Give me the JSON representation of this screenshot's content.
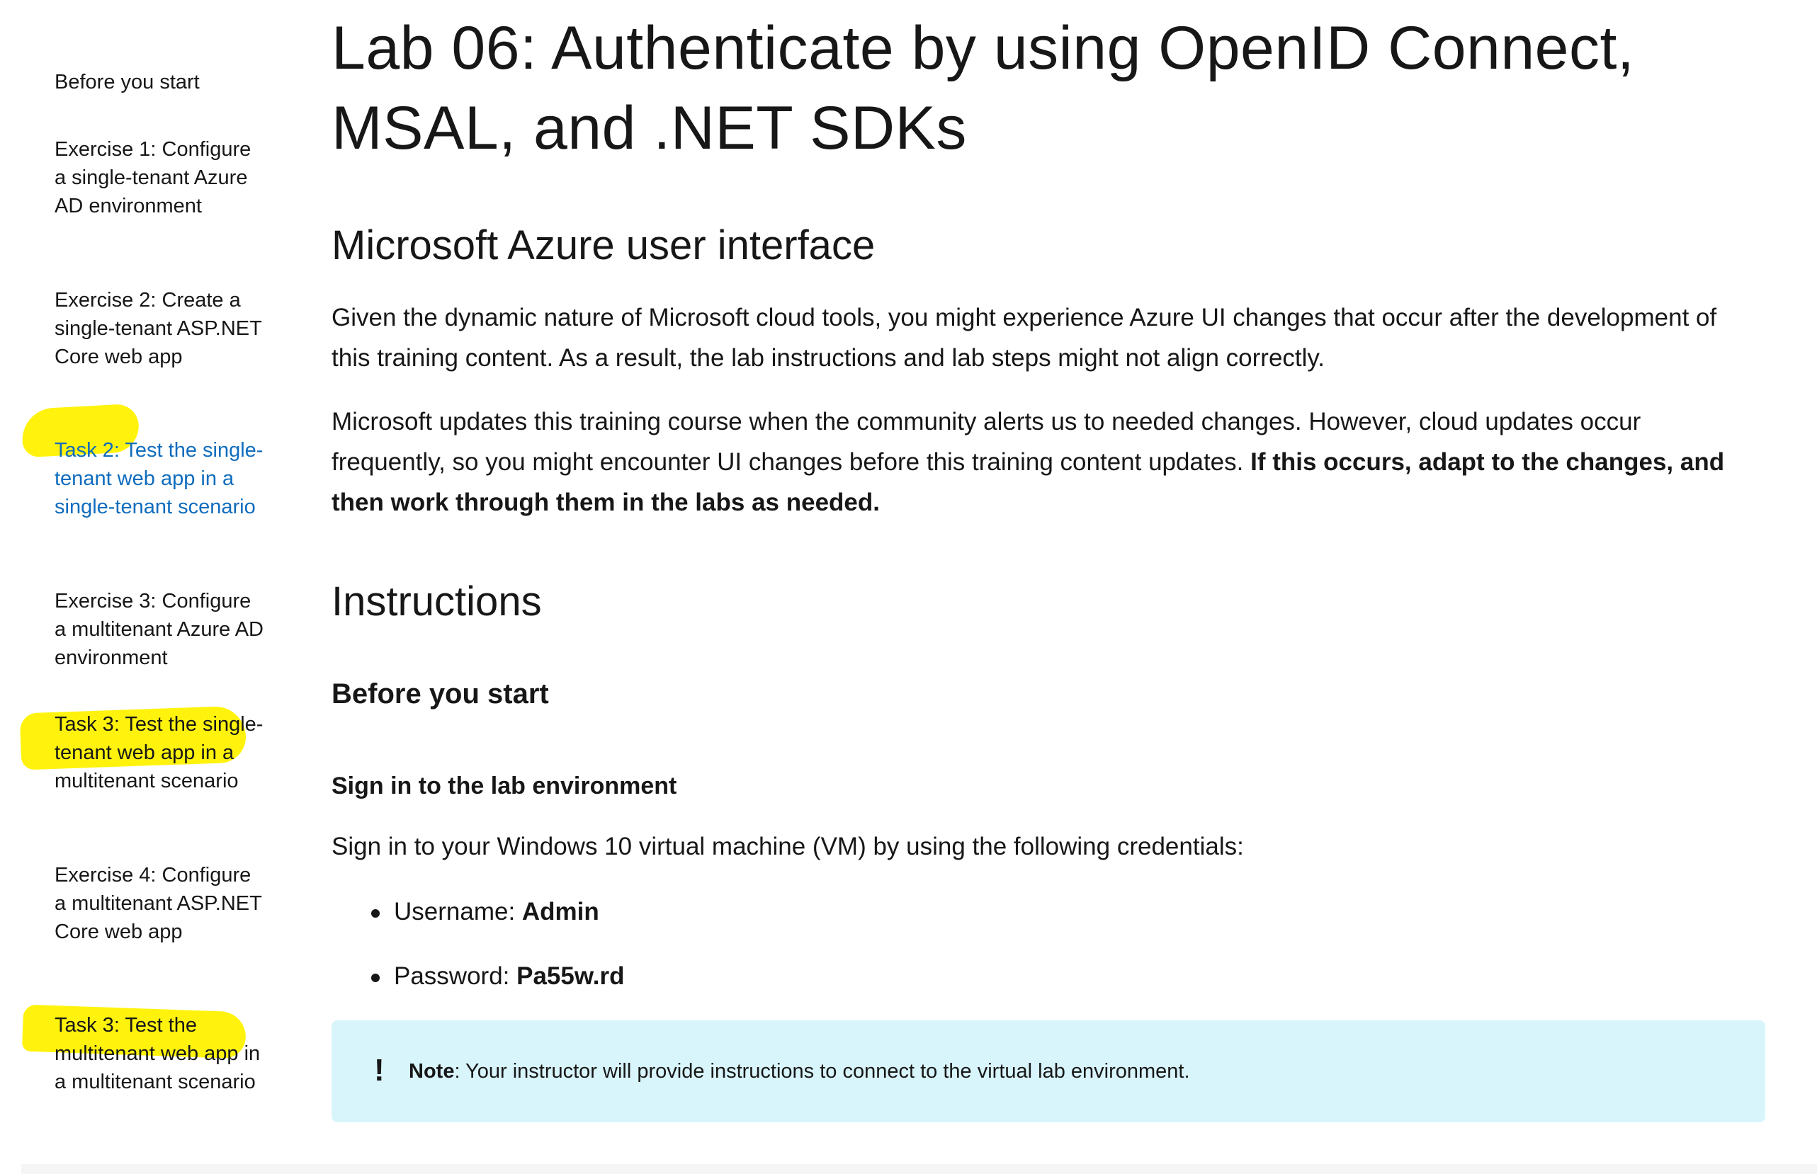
{
  "sidebar": {
    "items": [
      {
        "label": "Before you start",
        "active": false
      },
      {
        "label": "Exercise 1: Configure a single-tenant Azure AD environment",
        "active": false
      },
      {
        "label": "Exercise 2: Create a single-tenant ASP.NET Core web app",
        "active": false
      },
      {
        "label": "Task 2: Test the single-tenant web app in a single-tenant scenario",
        "active": true
      },
      {
        "label": "Exercise 3: Configure a multitenant Azure AD environment",
        "active": false
      },
      {
        "label": "Task 3: Test the single-tenant web app in a multitenant scenario",
        "active": false
      },
      {
        "label": "Exercise 4: Configure a multitenant ASP.NET Core web app",
        "active": false
      },
      {
        "label": "Task 3: Test the multitenant web app in a multitenant scenario",
        "active": false
      }
    ]
  },
  "main": {
    "title": "Lab 06: Authenticate by using OpenID Connect, MSAL, and .NET SDKs",
    "section_ui": {
      "heading": "Microsoft Azure user interface",
      "p1": "Given the dynamic nature of Microsoft cloud tools, you might experience Azure UI changes that occur after the development of this training content. As a result, the lab instructions and lab steps might not align correctly.",
      "p2_normal": "Microsoft updates this training course when the community alerts us to needed changes. However, cloud updates occur frequently, so you might encounter UI changes before this training content updates. ",
      "p2_bold": "If this occurs, adapt to the changes, and then work through them in the labs as needed."
    },
    "instructions": {
      "heading": "Instructions",
      "before_heading": "Before you start",
      "signin_heading": "Sign in to the lab environment",
      "signin_text": "Sign in to your Windows 10 virtual machine (VM) by using the following credentials:",
      "credentials": [
        {
          "label": "Username: ",
          "value": "Admin"
        },
        {
          "label": "Password: ",
          "value": "Pa55w.rd"
        }
      ],
      "note": {
        "icon": "exclamation-icon",
        "label": "Note",
        "text": ": Your instructor will provide instructions to connect to the virtual lab environment."
      }
    }
  },
  "colors": {
    "link_active": "#0f6cbd",
    "highlight": "#fff200",
    "note_bg": "#d9f5fc"
  }
}
